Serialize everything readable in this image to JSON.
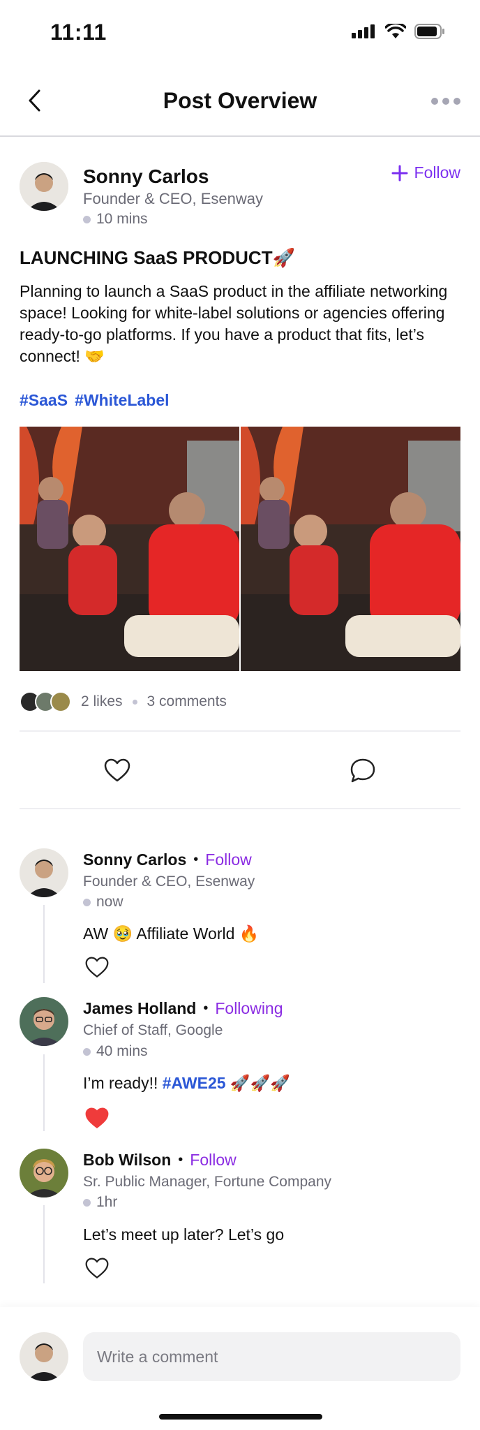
{
  "status": {
    "time": "11:11"
  },
  "header": {
    "title": "Post Overview"
  },
  "post": {
    "author": {
      "name": "Sonny Carlos",
      "title": "Founder & CEO, Esenway",
      "time": "10 mins"
    },
    "follow_label": "Follow",
    "heading": "LAUNCHING SaaS PRODUCT🚀",
    "body": "Planning to launch a SaaS product in the affiliate networking space! Looking for white-label solutions or agencies offering ready-to-go platforms. If you have a product that fits, let’s connect! 🤝",
    "hashtags": [
      "#SaaS",
      "#WhiteLabel"
    ],
    "likes": "2 likes",
    "comments": "3 comments"
  },
  "comments": [
    {
      "name": "Sonny Carlos",
      "follow": "Follow",
      "role": "Founder & CEO, Esenway",
      "time": "now",
      "text": "AW 🥹 Affiliate World 🔥",
      "liked": false
    },
    {
      "name": "James Holland",
      "follow": "Following",
      "role": "Chief of Staff, Google",
      "time": "40 mins",
      "text_prefix": "I’m ready!! ",
      "tag": "#AWE25",
      "text_suffix": " 🚀🚀🚀",
      "liked": true
    },
    {
      "name": "Bob Wilson",
      "follow": "Follow",
      "role": "Sr. Public Manager, Fortune Company",
      "time": "1hr",
      "text": "Let’s meet up later? Let’s go",
      "liked": false
    }
  ],
  "input": {
    "placeholder": "Write a comment"
  },
  "colors": {
    "accent": "#7b2ff0",
    "hashtag": "#2b57d6",
    "liked": "#ef3b3b",
    "muted": "#6b6b76"
  },
  "icons": [
    "back-chevron-icon",
    "more-dots-icon",
    "plus-icon",
    "heart-icon",
    "comment-bubble-icon",
    "signal-icon",
    "wifi-icon",
    "battery-icon"
  ]
}
